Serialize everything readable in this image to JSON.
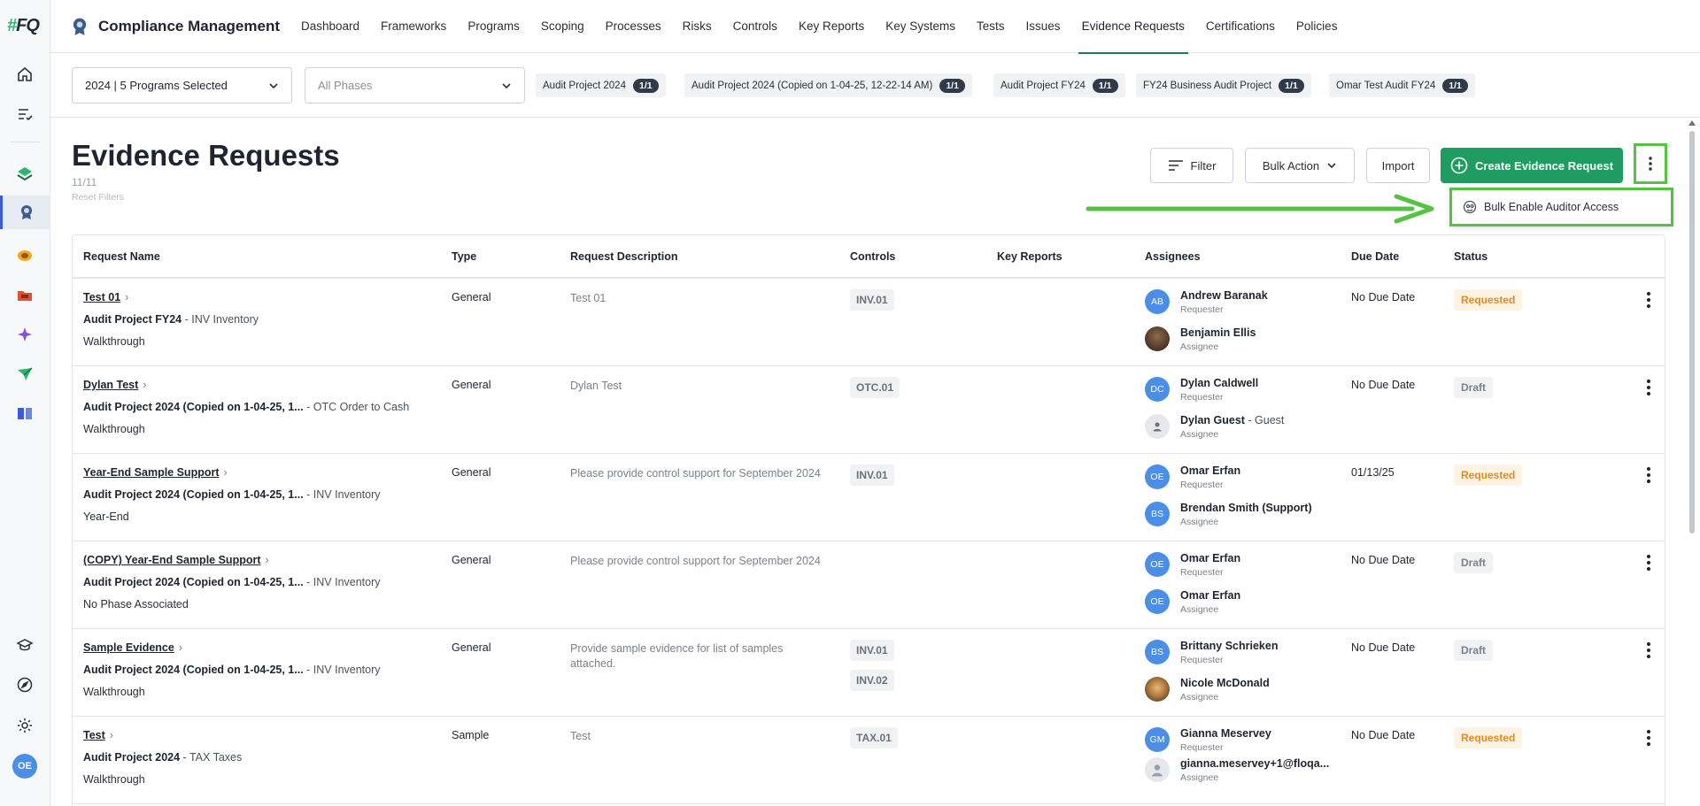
{
  "app": {
    "logo_text": "FQ",
    "title": "Compliance Management",
    "user_initials": "OE"
  },
  "nav": {
    "items": [
      "Dashboard",
      "Frameworks",
      "Programs",
      "Scoping",
      "Processes",
      "Risks",
      "Controls",
      "Key Reports",
      "Key Systems",
      "Tests",
      "Issues",
      "Evidence Requests",
      "Certifications",
      "Policies"
    ],
    "active": "Evidence Requests"
  },
  "filters": {
    "program_select": "2024 | 5 Programs Selected",
    "phase_select_placeholder": "All Phases",
    "chips": [
      {
        "label": "Audit Project 2024",
        "count": "1/1"
      },
      {
        "label": "Audit Project 2024 (Copied on 1-04-25, 12-22-14 AM)",
        "count": "1/1"
      },
      {
        "label": "Audit Project FY24",
        "count": "1/1"
      },
      {
        "label": "FY24 Business Audit Project",
        "count": "1/1"
      },
      {
        "label": "Omar Test Audit FY24",
        "count": "1/1"
      }
    ]
  },
  "page": {
    "title": "Evidence Requests",
    "count": "11/11",
    "reset_filters": "Reset Filters"
  },
  "toolbar": {
    "filter": "Filter",
    "bulk_action": "Bulk Action",
    "import": "Import",
    "create": "Create Evidence Request",
    "menu_item": "Bulk Enable Auditor Access"
  },
  "table": {
    "headers": [
      "Request Name",
      "Type",
      "Request Description",
      "Controls",
      "Key Reports",
      "Assignees",
      "Due Date",
      "Status"
    ],
    "rows": [
      {
        "name": "Test 01",
        "project": "Audit Project FY24",
        "process": "INV Inventory",
        "phase": "Walkthrough",
        "type": "General",
        "description": "Test 01",
        "controls": [
          "INV.01"
        ],
        "assignees": [
          {
            "initials": "AB",
            "name": "Andrew Baranak",
            "role": "Requester",
            "avatar": "initials"
          },
          {
            "initials": "",
            "name": "Benjamin Ellis",
            "role": "Assignee",
            "avatar": "photo"
          }
        ],
        "due": "No Due Date",
        "status": "Requested"
      },
      {
        "name": "Dylan Test",
        "project": "Audit Project 2024 (Copied on 1-04-25, 1...",
        "process": "OTC Order to Cash",
        "phase": "Walkthrough",
        "type": "General",
        "description": "Dylan Test",
        "controls": [
          "OTC.01"
        ],
        "assignees": [
          {
            "initials": "DC",
            "name": "Dylan Caldwell",
            "role": "Requester",
            "avatar": "initials"
          },
          {
            "initials": "",
            "name": "Dylan Guest",
            "suffix": "Guest",
            "role": "Assignee",
            "avatar": "guest"
          }
        ],
        "due": "No Due Date",
        "status": "Draft"
      },
      {
        "name": "Year-End Sample Support",
        "project": "Audit Project 2024 (Copied on 1-04-25, 1...",
        "process": "INV Inventory",
        "phase": "Year-End",
        "type": "General",
        "description": "Please provide control support for September 2024",
        "controls": [
          "INV.01"
        ],
        "assignees": [
          {
            "initials": "OE",
            "name": "Omar Erfan",
            "role": "Requester",
            "avatar": "initials"
          },
          {
            "initials": "BS",
            "name": "Brendan Smith (Support)",
            "role": "Assignee",
            "avatar": "initials"
          }
        ],
        "due": "01/13/25",
        "status": "Requested"
      },
      {
        "name": "(COPY) Year-End Sample Support",
        "project": "Audit Project 2024 (Copied on 1-04-25, 1...",
        "process": "INV Inventory",
        "phase": "No Phase Associated",
        "type": "General",
        "description": "Please provide control support for September 2024",
        "controls": [],
        "assignees": [
          {
            "initials": "OE",
            "name": "Omar Erfan",
            "role": "Requester",
            "avatar": "initials"
          },
          {
            "initials": "OE",
            "name": "Omar Erfan",
            "role": "Assignee",
            "avatar": "initials"
          }
        ],
        "due": "No Due Date",
        "status": "Draft"
      },
      {
        "name": "Sample Evidence",
        "project": "Audit Project 2024 (Copied on 1-04-25, 1...",
        "process": "INV Inventory",
        "phase": "Walkthrough",
        "type": "General",
        "description": "Provide sample evidence for list of samples attached.",
        "controls": [
          "INV.01",
          "INV.02"
        ],
        "assignees": [
          {
            "initials": "BS",
            "name": "Brittany Schrieken",
            "role": "Requester",
            "avatar": "initials"
          },
          {
            "initials": "",
            "name": "Nicole McDonald",
            "role": "Assignee",
            "avatar": "photo2"
          }
        ],
        "due": "No Due Date",
        "status": "Draft"
      },
      {
        "name": "Test",
        "project": "Audit Project 2024",
        "process": "TAX Taxes",
        "phase": "Walkthrough",
        "type": "Sample",
        "description": "Test",
        "controls": [
          "TAX.01"
        ],
        "assignees": [
          {
            "initials": "GM",
            "name": "Gianna Meservey",
            "role": "Requester",
            "avatar": "initials"
          },
          {
            "initials": "",
            "name": "gianna.meservey+1@floqa...",
            "role": "Assignee",
            "avatar": "grey-person"
          }
        ],
        "due": "No Due Date",
        "status": "Requested"
      }
    ]
  },
  "colors": {
    "primary": "#1f9d61",
    "highlight": "#56c244",
    "requested": "#e58a1f",
    "avatar": "#4a8ee8"
  }
}
